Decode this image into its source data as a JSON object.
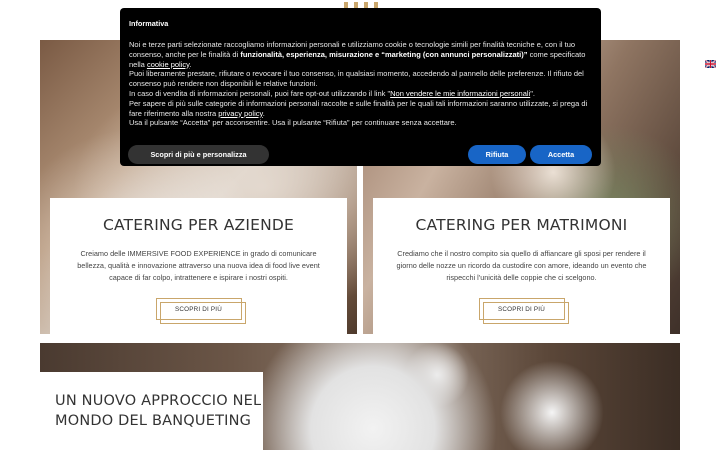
{
  "colors": {
    "accent_gold": "#c9a66b",
    "modal_bg": "#000000",
    "button_blue": "#1865c6",
    "button_dark": "#333333"
  },
  "header": {
    "logo_icon": "logo-icon",
    "language_flag_icon": "uk-flag-icon"
  },
  "cards": [
    {
      "title": "CATERING PER AZIENDE",
      "text": "Creiamo delle IMMERSIVE FOOD EXPERIENCE in grado di comunicare bellezza, qualità e innovazione attraverso una nuova idea di food live event capace di far colpo, intrattenere e ispirare i nostri ospiti.",
      "button_label": "SCOPRI DI PIÙ"
    },
    {
      "title": "CATERING PER MATRIMONI",
      "text": "Crediamo che il nostro compito sia quello di affiancare gli sposi per rendere il giorno delle nozze un ricordo da custodire con amore, ideando un evento che rispecchi l'unicità delle coppie che ci scelgono.",
      "button_label": "SCOPRI DI PIÙ"
    }
  ],
  "banquet": {
    "heading": "UN NUOVO APPROCCIO NEL MONDO DEL BANQUETING"
  },
  "cookie_banner": {
    "title": "Informativa",
    "p1_a": "Noi e terze parti selezionate raccogliamo informazioni personali e utilizziamo cookie o tecnologie simili per finalità tecniche e, con il tuo consenso, anche per le finalità di ",
    "p1_bold": "funzionalità, esperienza, misurazione e “marketing (con annunci personalizzati)”",
    "p1_b": " come specificato nella ",
    "p1_link": "cookie policy",
    "p1_c": ".",
    "p2": "Puoi liberamente prestare, rifiutare o revocare il tuo consenso, in qualsiasi momento, accedendo al pannello delle preferenze. Il rifiuto del consenso può rendere non disponibili le relative funzioni.",
    "p3_a": "In caso di vendita di informazioni personali, puoi fare opt-out utilizzando il link \"",
    "p3_link": "Non vendere le mie informazioni personali",
    "p3_b": "\".",
    "p4_a": "Per sapere di più sulle categorie di informazioni personali raccolte e sulle finalità per le quali tali informazioni saranno utilizzate, si prega di fare riferimento alla nostra ",
    "p4_link": "privacy policy",
    "p4_b": ".",
    "p5": "Usa il pulsante “Accetta” per acconsentire. Usa il pulsante “Rifiuta” per continuare senza accettare.",
    "customize_label": "Scopri di più e personalizza",
    "reject_label": "Rifiuta",
    "accept_label": "Accetta"
  }
}
